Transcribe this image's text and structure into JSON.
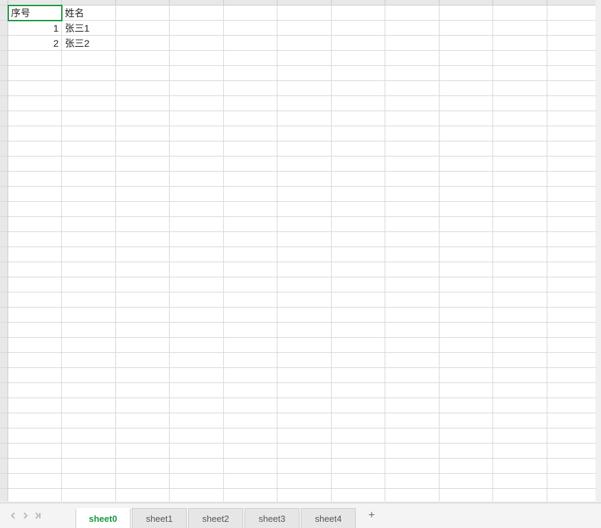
{
  "grid": {
    "cols": 11,
    "rows": 34,
    "selected": {
      "row": 0,
      "col": 0
    },
    "data": [
      [
        "序号",
        "姓名"
      ],
      [
        "1",
        "张三1"
      ],
      [
        "2",
        "张三2"
      ]
    ],
    "numeric_cols": [
      0
    ]
  },
  "tabs": {
    "items": [
      "sheet0",
      "sheet1",
      "sheet2",
      "sheet3",
      "sheet4"
    ],
    "active": 0
  }
}
